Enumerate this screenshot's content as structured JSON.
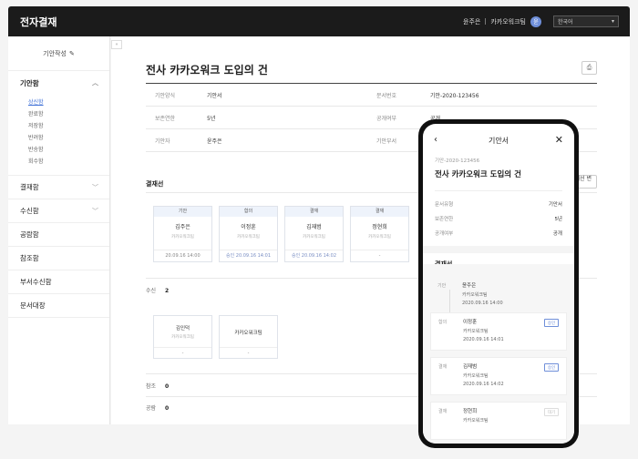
{
  "app": {
    "title": "전자결재"
  },
  "header": {
    "user_name": "윤주은",
    "company": "카카오워크팀",
    "avatar_text": "윤",
    "language": "한국어"
  },
  "sidebar": {
    "compose_label": "기안작성",
    "menus": [
      {
        "label": "기안함",
        "open": true,
        "submenu": [
          "상신함",
          "완료함",
          "저장함",
          "반려함",
          "반송함",
          "회수함"
        ]
      },
      {
        "label": "결재함",
        "open": false,
        "submenu": []
      },
      {
        "label": "수신함",
        "open": false,
        "submenu": []
      },
      {
        "label": "공람함",
        "open": false,
        "submenu": []
      },
      {
        "label": "참조함",
        "open": false,
        "submenu": []
      },
      {
        "label": "부서수신함",
        "open": false,
        "submenu": []
      },
      {
        "label": "문서대장",
        "open": false,
        "submenu": []
      }
    ]
  },
  "document": {
    "title": "전사 카카오워크 도입의 건",
    "info_rows": [
      {
        "label1": "기안양식",
        "value1": "기안서",
        "label2": "문서번호",
        "value2": "기안-2020-123456"
      },
      {
        "label1": "보존연한",
        "value1": "5년",
        "label2": "공개여부",
        "value2": "공개"
      },
      {
        "label1": "기안자",
        "value1": "윤주은",
        "label2": "기안부서",
        "value2": ""
      }
    ],
    "approval_line_title": "결재선",
    "change_button": "결재선 변경",
    "approval_cards": [
      {
        "type": "기안",
        "name": "김주은",
        "company": "카카오워크팀",
        "footer": "20.09.16 14:00"
      },
      {
        "type": "합의",
        "name": "이정훈",
        "company": "카카오워크팀",
        "footer": "승인 20.09.16 14:01"
      },
      {
        "type": "결재",
        "name": "김재범",
        "company": "카카오워크팀",
        "footer": "승인 20.09.16 14:02"
      },
      {
        "type": "결재",
        "name": "정현희",
        "company": "카카오워크팀",
        "footer": "-"
      }
    ],
    "receivers_label": "수신",
    "receivers_count": "2",
    "receiver_cards": [
      {
        "name": "김인덕",
        "company": "카카오워크팀",
        "footer": "-"
      },
      {
        "name": "카카오워크팀",
        "company": "",
        "footer": "-"
      }
    ],
    "ref_label": "참조",
    "ref_count": "0",
    "public_label": "공람",
    "public_count": "0"
  },
  "mobile": {
    "header_title": "기안서",
    "doc_no": "기안-2020-123456",
    "title": "전사 카카오워크 도입의 건",
    "info": [
      {
        "label": "문서유형",
        "value": "기안서"
      },
      {
        "label": "보존연한",
        "value": "5년"
      },
      {
        "label": "공개여부",
        "value": "공개"
      }
    ],
    "approval_title": "결재선",
    "steps": [
      {
        "type": "기안",
        "name": "윤주은",
        "company": "카카오워크팀",
        "time": "2020.09.16 14:00",
        "badge": ""
      },
      {
        "type": "합의",
        "name": "이정훈",
        "company": "카카오워크팀",
        "time": "2020.09.16 14:01",
        "badge": "승인"
      },
      {
        "type": "결재",
        "name": "김재범",
        "company": "카카오워크팀",
        "time": "2020.09.16 14:02",
        "badge": "승인"
      },
      {
        "type": "결재",
        "name": "정현희",
        "company": "카카오워크팀",
        "time": "",
        "badge": "대기"
      }
    ]
  }
}
